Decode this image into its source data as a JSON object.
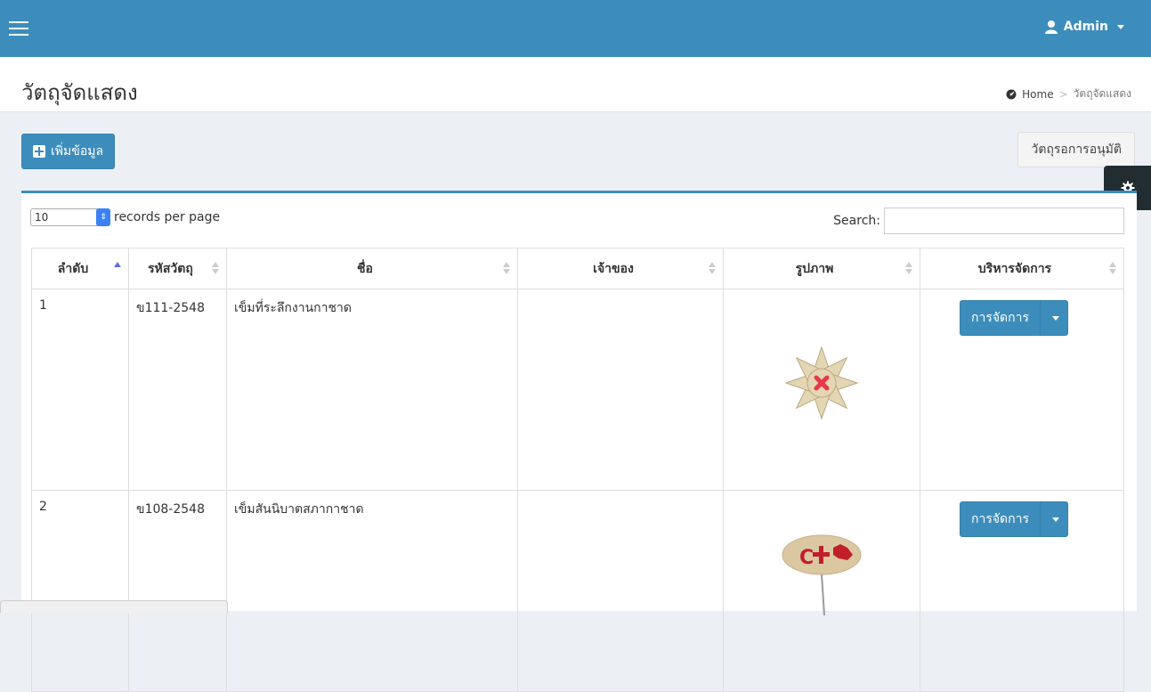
{
  "header": {
    "menu_icon": "hamburger-icon",
    "user_icon": "user-icon",
    "user_label": "Admin",
    "brand_color": "#3c8dbc"
  },
  "content_header": {
    "title": "วัตถุจัดแสดง",
    "breadcrumb": {
      "home_icon": "dashboard-icon",
      "home": "Home",
      "separator": ">",
      "current": "วัตถุจัดแสดง"
    }
  },
  "toolbar": {
    "add_label": "เพิ่มข้อมูล",
    "approve_label": "วัตถุรอการอนุมัติ"
  },
  "table_controls": {
    "page_length": "10",
    "records_label": "records per page",
    "search_label": "Search:",
    "search_value": ""
  },
  "table": {
    "columns": [
      "ลำดับ",
      "รหัสวัตถุ",
      "ชื่อ",
      "เจ้าของ",
      "รูปภาพ",
      "บริหารจัดการ"
    ],
    "rows": [
      {
        "no": "1",
        "code": "ข111-2548",
        "name": "เข็มที่ระลึกงานกาชาด",
        "owner": "",
        "image": "star-badge-image",
        "action": "การจัดการ"
      },
      {
        "no": "2",
        "code": "ข108-2548",
        "name": "เข็มสันนิบาตสภากาชาด",
        "owner": "",
        "image": "red-cross-pin-image",
        "action": "การจัดการ"
      }
    ]
  },
  "settings_icon": "gear-icon"
}
